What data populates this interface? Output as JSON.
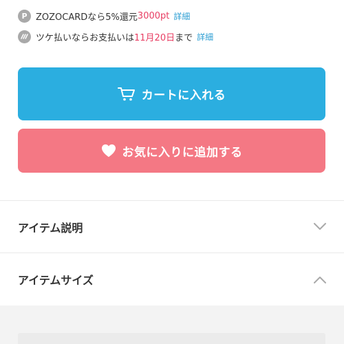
{
  "colors": {
    "cart_button": "#2baee0",
    "favorite_button": "#f47884",
    "highlight": "#e83d62",
    "link": "#2f9fd3"
  },
  "promos": [
    {
      "icon": "p-point-icon",
      "icon_glyph": "P",
      "text_before": "ZOZOCARDなら5%還元",
      "highlight": "3000pt",
      "text_after": "",
      "detail_link": "詳細"
    },
    {
      "icon": "tsuke-icon",
      "icon_glyph": "〰",
      "text_before": "ツケ払いならお支払いは",
      "highlight": "11月20日",
      "text_after": "まで",
      "detail_link": "詳細"
    }
  ],
  "buttons": {
    "cart": {
      "label": "カートに入れる",
      "icon": "cart-icon"
    },
    "favorite": {
      "label": "お気に入りに追加する",
      "icon": "heart-icon"
    }
  },
  "accordion": [
    {
      "title": "アイテム説明",
      "state": "collapsed",
      "icon": "chevron-down-icon"
    },
    {
      "title": "アイテムサイズ",
      "state": "expanded",
      "icon": "chevron-up-icon"
    }
  ]
}
